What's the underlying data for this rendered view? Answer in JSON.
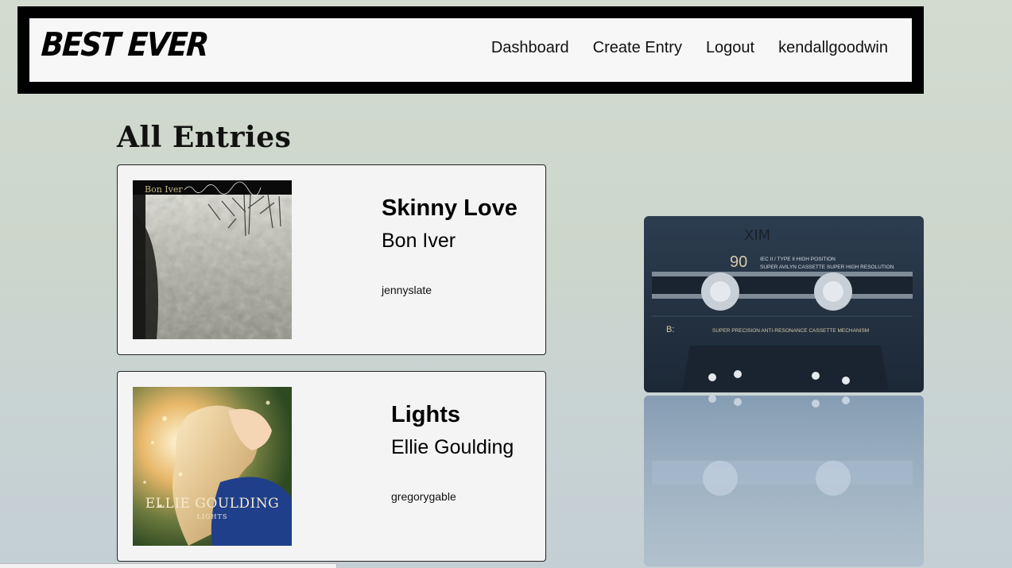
{
  "header": {
    "logo": "BEST EVER",
    "nav": {
      "dashboard": "Dashboard",
      "create_entry": "Create Entry",
      "logout": "Logout",
      "username": "kendallgoodwin"
    }
  },
  "main": {
    "title": "All Entries",
    "entries": [
      {
        "title": "Skinny Love",
        "artist": "Bon Iver",
        "user": "jennyslate",
        "cover_text": "Bon Iver"
      },
      {
        "title": "Lights",
        "artist": "Ellie Goulding",
        "user": "gregorygable",
        "cover_text": "ELLIE GOULDING",
        "cover_subtext": "LIGHTS"
      }
    ]
  },
  "cassette": {
    "label_number": "90",
    "label_type": "IEC II / TYPE II  HIGH POSITION",
    "label_line2": "SUPER AVILYN CASSETTE SUPER HIGH RESOLUTION",
    "side": "B:",
    "mechanism": "SUPER PRECISION ANTI-RESONANCE CASSETTE MECHANISM",
    "handwriting": "XIM"
  },
  "colors": {
    "header_border": "#000000",
    "header_bg": "#f7f7f7",
    "card_bg": "#f4f4f4",
    "page_bg": "#cfd8ce"
  }
}
